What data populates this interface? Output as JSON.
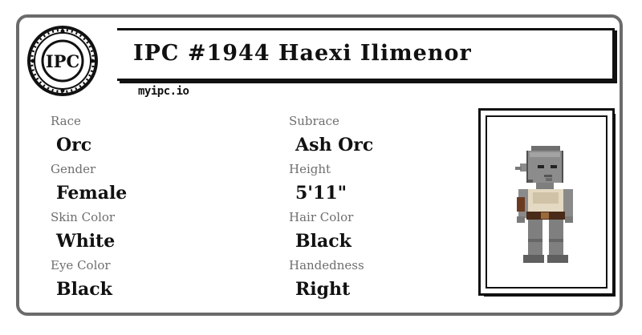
{
  "logo": {
    "text": "IPC",
    "icon": "ipc-badge-icon"
  },
  "title": "IPC #1944 Haexi Ilimenor",
  "site": "myipc.io",
  "fields": [
    {
      "label": "Race",
      "value": "Orc"
    },
    {
      "label": "Subrace",
      "value": "Ash Orc"
    },
    {
      "label": "Gender",
      "value": "Female"
    },
    {
      "label": "Height",
      "value": "5'11\""
    },
    {
      "label": "Skin Color",
      "value": "White"
    },
    {
      "label": "Hair Color",
      "value": "Black"
    },
    {
      "label": "Eye Color",
      "value": "Black"
    },
    {
      "label": "Handedness",
      "value": "Right"
    }
  ],
  "portrait": {
    "icon": "orc-character-sprite-icon"
  },
  "colors": {
    "border": "#6b6b6b",
    "label": "#6e6e6e",
    "text": "#111111",
    "skin": "#8a8a8a"
  }
}
